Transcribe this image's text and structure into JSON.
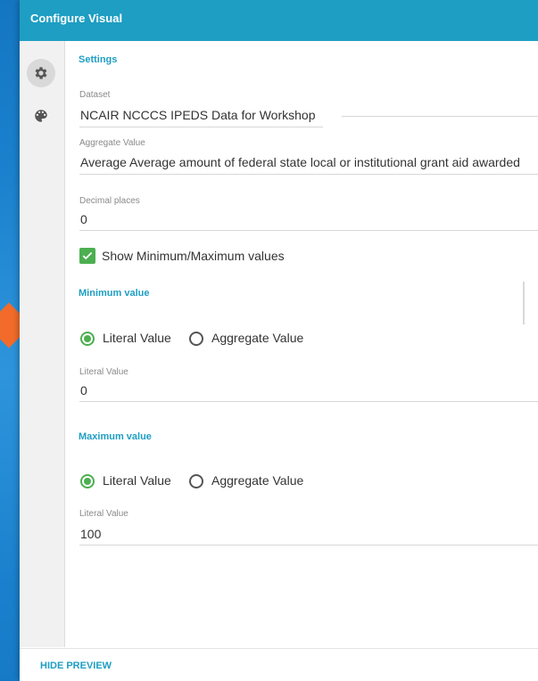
{
  "header": {
    "title": "Configure Visual"
  },
  "sidebar": {
    "items": [
      {
        "icon": "gear-icon",
        "active": true
      },
      {
        "icon": "palette-icon",
        "active": false
      }
    ]
  },
  "settings": {
    "title": "Settings",
    "dataset": {
      "label": "Dataset",
      "value": "NCAIR NCCCS IPEDS Data for Workshop"
    },
    "aggregate": {
      "label": "Aggregate Value",
      "value": "Average Average amount of federal state local or institutional grant aid awarded"
    },
    "decimal_places": {
      "label": "Decimal places",
      "value": "0"
    },
    "show_minmax": {
      "label": "Show Minimum/Maximum values",
      "checked": true
    }
  },
  "minimum": {
    "title": "Minimum value",
    "options": [
      "Literal Value",
      "Aggregate Value"
    ],
    "selected": "Literal Value",
    "literal_label": "Literal Value",
    "literal_value": "0"
  },
  "maximum": {
    "title": "Maximum value",
    "options": [
      "Literal Value",
      "Aggregate Value"
    ],
    "selected": "Literal Value",
    "literal_label": "Literal Value",
    "literal_value": "100"
  },
  "footer": {
    "hide_preview": "HIDE PREVIEW"
  },
  "colors": {
    "accent": "#1e9ec3",
    "background": "#1177c4",
    "arrow": "#f26b2a",
    "checked": "#4caf50"
  }
}
